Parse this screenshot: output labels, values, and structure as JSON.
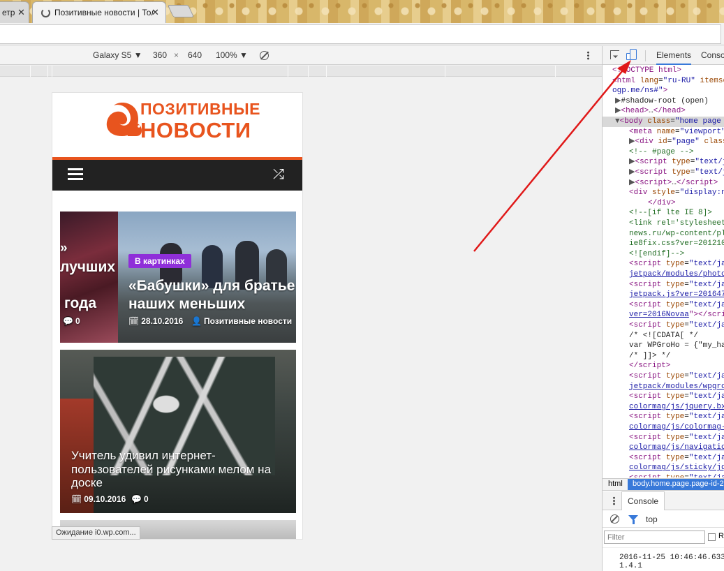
{
  "browser": {
    "tabs": [
      {
        "title": "етр",
        "close_label": "✕"
      },
      {
        "title": "Позитивные новости | Тол",
        "close_label": "✕"
      }
    ]
  },
  "device_toolbar": {
    "device": "Galaxy S5",
    "width": "360",
    "times": "×",
    "height": "640",
    "zoom": "100%"
  },
  "site": {
    "logo_line1": "ПОЗИТИВНЫЕ",
    "logo_line2": "НОВОСТИ",
    "slides": [
      {
        "title_line1": "»",
        "title_line2": "лучших",
        "title_line3": "года",
        "comments": "0"
      },
      {
        "category": "В картинках",
        "title_line1": "«Бабушки» для братье",
        "title_line2": "наших меньших",
        "date": "28.10.2016",
        "author": "Позитивные новости"
      }
    ],
    "articles": [
      {
        "title": "Учитель удивил интернет-пользователей рисунками мелом на доске",
        "date": "09.10.2016",
        "comments": "0"
      }
    ],
    "status": "Ожидание i0.wp.com..."
  },
  "devtools": {
    "tabs": {
      "elements": "Elements",
      "console": "Conso"
    },
    "dom_lines": [
      {
        "i": 0,
        "html": "<span class='tg'>&lt;!DOCTYPE html&gt;</span>"
      },
      {
        "i": 0,
        "html": "<span class='tg'>&lt;html</span> <span class='at'>lang</span>=<span class='av'>\"ru-RU\"</span> <span class='at'>itemsc</span>"
      },
      {
        "i": 0,
        "html": "<span class='av'>ogp.me/ns#\"</span><span class='tg'>&gt;</span>"
      },
      {
        "i": 1,
        "html": "<span class='tri'>▶</span><span class='tx'>#shadow-root (open)</span>"
      },
      {
        "i": 1,
        "html": "<span class='tri'>▶</span><span class='tg'>&lt;head&gt;</span><span class='tx'>…</span><span class='tg'>&lt;/head&gt;</span>"
      },
      {
        "i": 1,
        "sel": true,
        "html": "<span class='tri'>▼</span><span class='tg'>&lt;body</span> <span class='at'>class</span>=<span class='av'>\"home page</span>"
      },
      {
        "i": 2,
        "html": "<span class='tg'>&lt;meta</span> <span class='at'>name</span>=<span class='av'>\"viewport\"</span>"
      },
      {
        "i": 2,
        "html": "<span class='tri'>▶</span><span class='tg'>&lt;div</span> <span class='at'>id</span>=<span class='av'>\"page\"</span> <span class='at'>class</span>="
      },
      {
        "i": 2,
        "html": "<span class='cm'>&lt;!-- #page --&gt;</span>"
      },
      {
        "i": 2,
        "html": "<span class='tri'>▶</span><span class='tg'>&lt;script</span> <span class='at'>type</span>=<span class='av'>\"text/ja</span>"
      },
      {
        "i": 2,
        "html": "<span class='tri'>▶</span><span class='tg'>&lt;script</span> <span class='at'>type</span>=<span class='av'>\"text/ja</span>"
      },
      {
        "i": 2,
        "html": "<span class='tri'>▶</span><span class='tg'>&lt;script&gt;</span><span class='tx'>…</span><span class='tg'>&lt;/script&gt;</span>"
      },
      {
        "i": 2,
        "html": "<span class='tg'>&lt;div</span> <span class='at'>style</span>=<span class='av'>\"display:n</span>"
      },
      {
        "i": 3,
        "html": "<span class='tg'>&lt;/div&gt;</span>"
      },
      {
        "i": 2,
        "html": "<span class='cm'>&lt;!--[if lte IE 8]&gt;</span>"
      },
      {
        "i": 2,
        "html": "<span class='cm'>&lt;link rel='stylesheet</span>"
      },
      {
        "i": 2,
        "html": "<span class='cm'>news.ru/wp-content/pl</span>"
      },
      {
        "i": 2,
        "html": "<span class='cm'>ie8fix.css?ver=201210</span>"
      },
      {
        "i": 2,
        "html": "<span class='cm'>&lt;![endif]--&gt;</span>"
      },
      {
        "i": 2,
        "html": "<span class='tg'>&lt;script</span> <span class='at'>type</span>=<span class='av'>\"text/ja</span>"
      },
      {
        "i": 2,
        "html": "<span class='lnk'>jetpack/modules/photo</span>"
      },
      {
        "i": 2,
        "html": "<span class='tg'>&lt;script</span> <span class='at'>type</span>=<span class='av'>\"text/ja</span>"
      },
      {
        "i": 2,
        "html": "<span class='lnk'>jetpack.js?ver=201647</span>"
      },
      {
        "i": 2,
        "html": "<span class='tg'>&lt;script</span> <span class='at'>type</span>=<span class='av'>\"text/ja</span>"
      },
      {
        "i": 2,
        "html": "<span class='lnk'>ver=2016Novaa</span><span class='tg'>\"&gt;&lt;/scri</span>"
      },
      {
        "i": 2,
        "html": "<span class='tg'>&lt;script</span> <span class='at'>type</span>=<span class='av'>\"text/ja</span>"
      },
      {
        "i": 2,
        "html": "<span class='tx'>/* &lt;![CDATA[ */</span>"
      },
      {
        "i": 2,
        "html": "<span class='tx'>var WPGroHo = {\"my_ha</span>"
      },
      {
        "i": 2,
        "html": "<span class='tx'>/* ]]&gt; */</span>"
      },
      {
        "i": 2,
        "html": "<span class='tg'>&lt;/script&gt;</span>"
      },
      {
        "i": 2,
        "html": "<span class='tg'>&lt;script</span> <span class='at'>type</span>=<span class='av'>\"text/ja</span>"
      },
      {
        "i": 2,
        "html": "<span class='lnk'>jetpack/modules/wpgro</span>"
      },
      {
        "i": 2,
        "html": "<span class='tg'>&lt;script</span> <span class='at'>type</span>=<span class='av'>\"text/ja</span>"
      },
      {
        "i": 2,
        "html": "<span class='lnk'>colormag/js/jquery.bx</span>"
      },
      {
        "i": 2,
        "html": "<span class='tg'>&lt;script</span> <span class='at'>type</span>=<span class='av'>\"text/ja</span>"
      },
      {
        "i": 2,
        "html": "<span class='lnk'>colormag/js/colormag-</span>"
      },
      {
        "i": 2,
        "html": "<span class='tg'>&lt;script</span> <span class='at'>type</span>=<span class='av'>\"text/ja</span>"
      },
      {
        "i": 2,
        "html": "<span class='lnk'>colormag/js/navigatio</span>"
      },
      {
        "i": 2,
        "html": "<span class='tg'>&lt;script</span> <span class='at'>type</span>=<span class='av'>\"text/ja</span>"
      },
      {
        "i": 2,
        "html": "<span class='lnk'>colormag/js/sticky/jq</span>"
      },
      {
        "i": 2,
        "html": "<span class='tg'>&lt;script</span> <span class='at'>type</span>=<span class='av'>\"text/ja</span>"
      }
    ],
    "breadcrumbs": {
      "html": "html",
      "body": "body.home.page.page-id-2"
    },
    "console": {
      "tab": "Console",
      "context": "top",
      "filter_placeholder": "Filter",
      "checkbox_label": "R",
      "log_line1": "2016-11-25 10:46:46.633",
      "log_line2": "1.4.1"
    }
  }
}
